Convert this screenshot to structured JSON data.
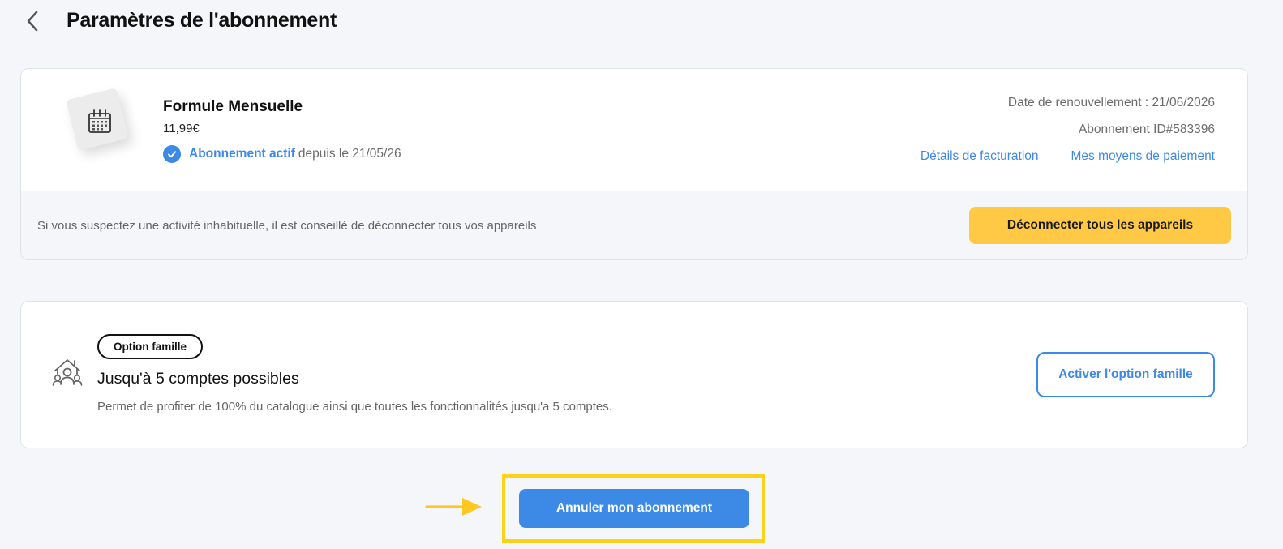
{
  "header": {
    "title": "Paramètres de l'abonnement",
    "back_icon": "chevron-left-icon"
  },
  "subscription": {
    "plan_name": "Formule Mensuelle",
    "price": "11,99€",
    "status_label": "Abonnement actif",
    "status_since": "depuis le 21/05/26",
    "renewal": "Date de renouvellement : 21/06/2026",
    "subscription_id": "Abonnement ID#583396",
    "billing_link": "Détails de facturation",
    "payment_link": "Mes moyens de paiement",
    "plan_icon": "calendar-icon",
    "status_icon": "check-circle-icon"
  },
  "security": {
    "warning": "Si vous suspectez une activité inhabituelle, il est conseillé de déconnecter tous vos appareils",
    "disconnect_label": "Déconnecter tous les appareils"
  },
  "family": {
    "badge": "Option famille",
    "title": "Jusqu'à 5 comptes possibles",
    "description": "Permet de profiter de 100% du catalogue ainsi que toutes les fonctionnalités jusqu'a 5 comptes.",
    "activate_label": "Activer l'option famille",
    "icon": "family-home-icon"
  },
  "cancel": {
    "label": "Annuler mon abonnement"
  },
  "colors": {
    "accent_blue": "#3d8ae6",
    "warning_yellow": "#ffc845",
    "highlight_yellow": "#ffd21a",
    "background": "#f4f6f9"
  }
}
